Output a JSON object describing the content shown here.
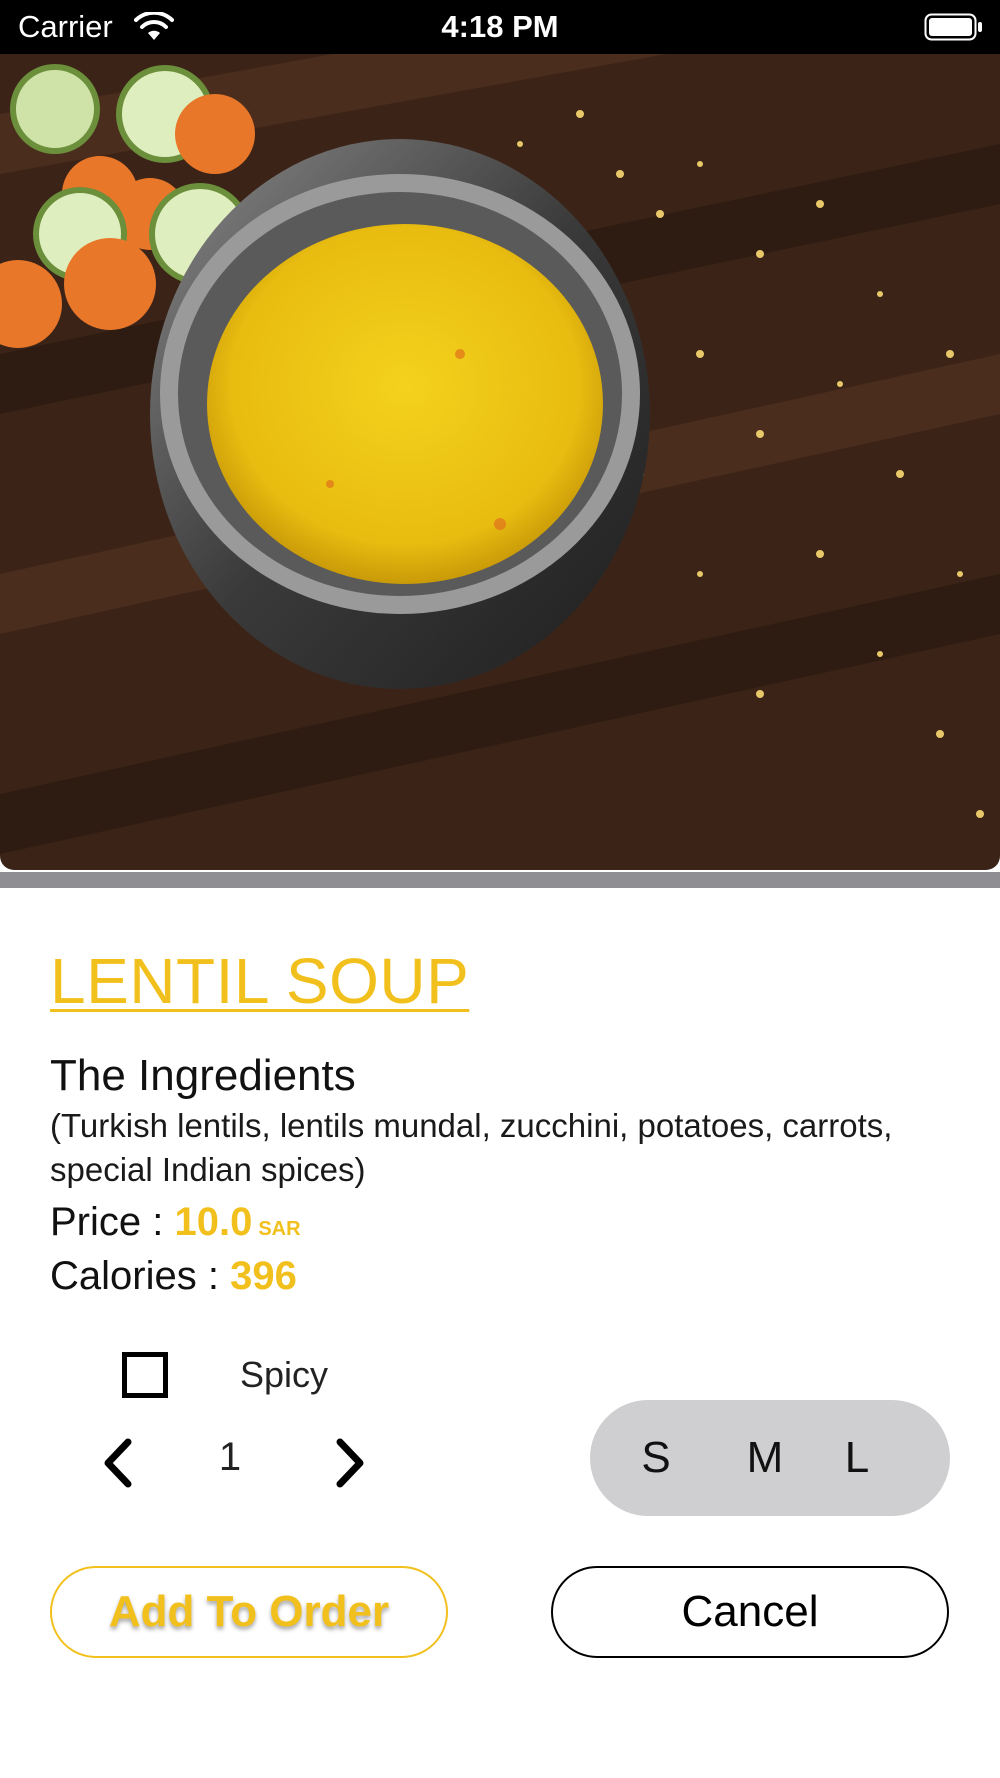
{
  "status_bar": {
    "carrier": "Carrier",
    "time": "4:18 PM",
    "icons": [
      "wifi-icon",
      "battery-icon"
    ]
  },
  "hero_image": {
    "subject": "lentil-soup-photo"
  },
  "dish": {
    "title": "LENTIL SOUP",
    "ingredients_heading": "The Ingredients",
    "ingredients": "(Turkish lentils, lentils mundal, zucchini, potatoes, carrots, special Indian spices)",
    "price_label": "Price :",
    "price_value": "10.0",
    "currency": "SAR",
    "calories_label": "Calories :",
    "calories_value": "396"
  },
  "options": {
    "spicy_label": "Spicy",
    "spicy_checked": false,
    "quantity": "1",
    "sizes": [
      "S",
      "M",
      "L"
    ]
  },
  "actions": {
    "add_label": "Add To Order",
    "cancel_label": "Cancel"
  },
  "colors": {
    "accent": "#f2c01c",
    "size_pill": "#cfcfd1",
    "divider": "#8e8e93"
  }
}
